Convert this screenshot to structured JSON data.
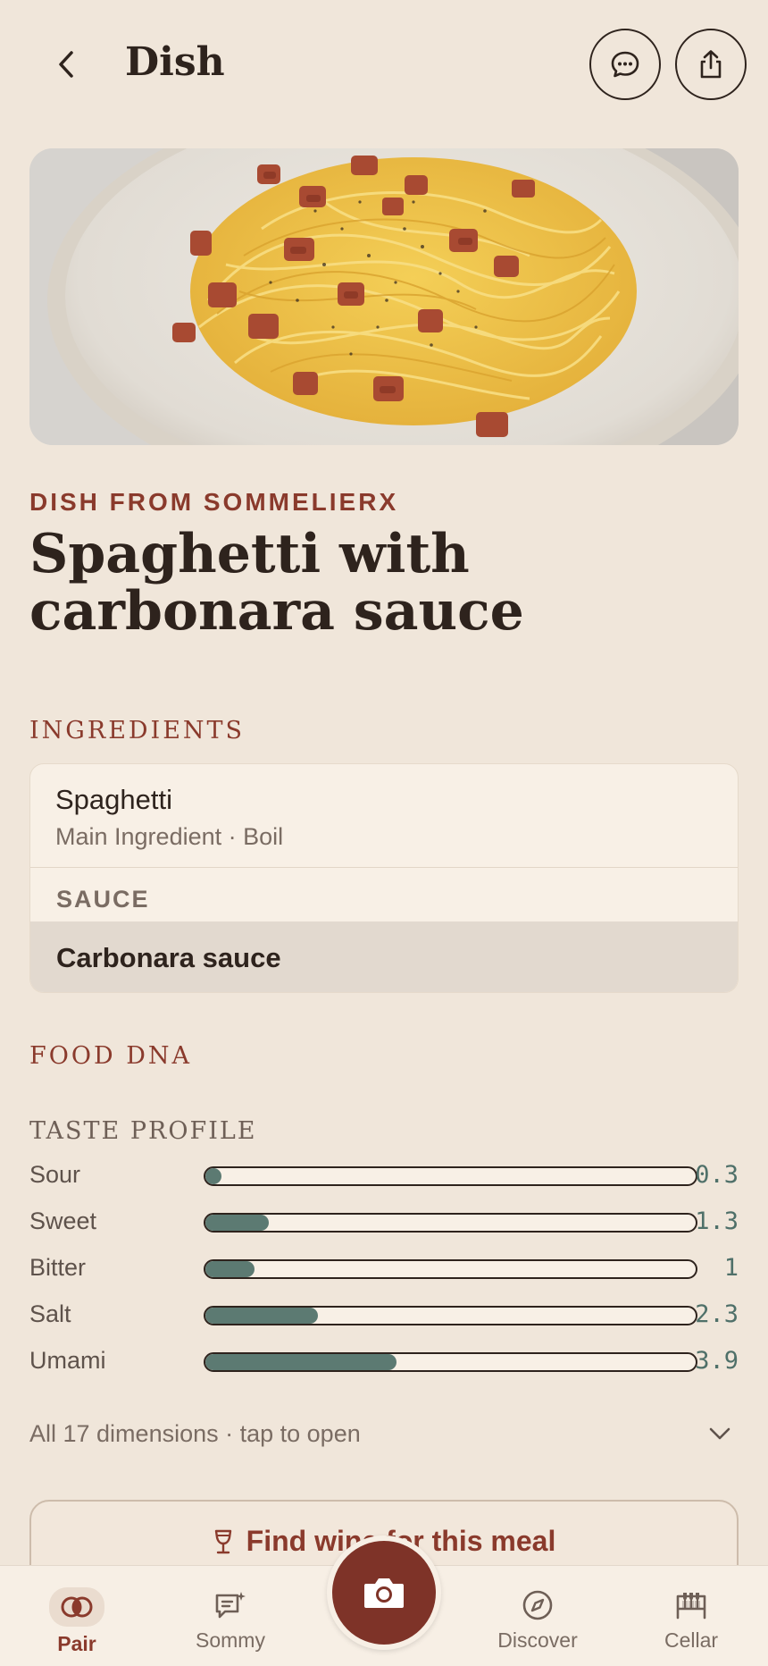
{
  "header": {
    "title": "Dish"
  },
  "hero": {
    "image_alt": "Spaghetti carbonara on a plate"
  },
  "dish": {
    "eyebrow": "DISH FROM SOMMELIERX",
    "name": "Spaghetti with carbonara sauce"
  },
  "ingredients": {
    "label": "INGREDIENTS",
    "items": [
      {
        "name": "Spaghetti",
        "detail": "Main Ingredient · Boil"
      }
    ],
    "sauce_label": "SAUCE",
    "sauce_name": "Carbonara sauce"
  },
  "food_dna": {
    "label": "FOOD DNA",
    "taste_profile_label": "TASTE PROFILE",
    "scale_max": 10,
    "tastes": [
      {
        "name": "Sour",
        "value": 0.3,
        "display": "0.3"
      },
      {
        "name": "Sweet",
        "value": 1.3,
        "display": "1.3"
      },
      {
        "name": "Bitter",
        "value": 1,
        "display": "1"
      },
      {
        "name": "Salt",
        "value": 2.3,
        "display": "2.3"
      },
      {
        "name": "Umami",
        "value": 3.9,
        "display": "3.9"
      }
    ],
    "dimensions_text": "All 17 dimensions · tap to open"
  },
  "find_wine": {
    "label": "Find wine for this meal"
  },
  "nav": {
    "items": [
      {
        "label": "Pair",
        "icon": "pair-icon",
        "active": true
      },
      {
        "label": "Sommy",
        "icon": "chat-sparkle-icon",
        "active": false
      },
      {
        "label": "Discover",
        "icon": "compass-icon",
        "active": false
      },
      {
        "label": "Cellar",
        "icon": "cellar-icon",
        "active": false
      }
    ]
  },
  "colors": {
    "background": "#F0E6DA",
    "accent": "#8A3A2C",
    "camera": "#7E3328",
    "bar_fill": "#5C7A72",
    "value_text": "#4F7069"
  }
}
